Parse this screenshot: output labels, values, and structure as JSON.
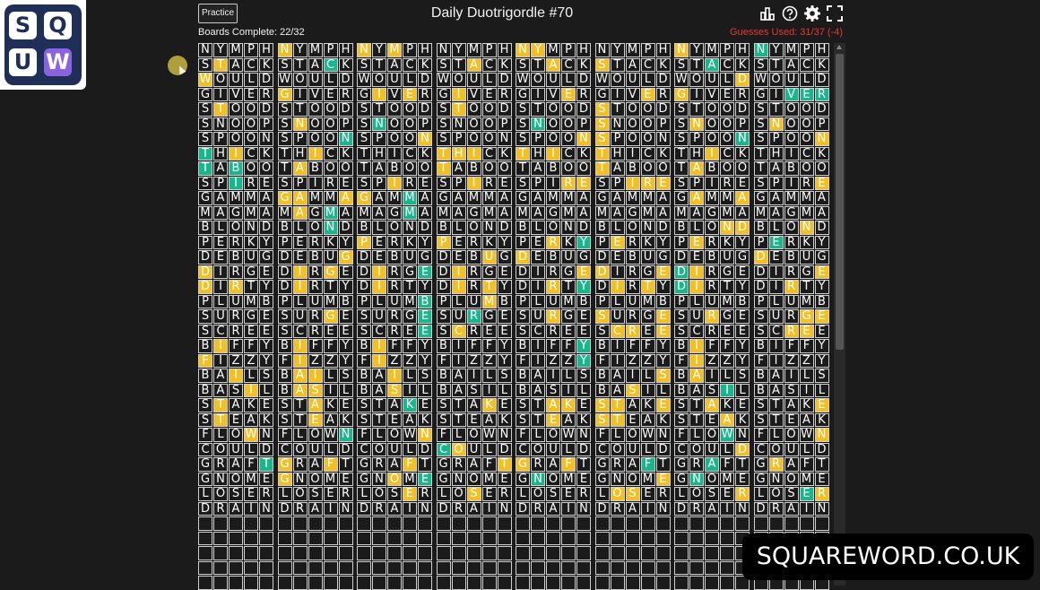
{
  "logo": {
    "letters": [
      "S",
      "Q",
      "U",
      "W"
    ]
  },
  "header": {
    "practice_label": "Practice",
    "title": "Daily Duotrigordle #70",
    "boards_complete": "Boards Complete: 22/32",
    "guesses_used": "Guesses Used: 31/37 (-4)"
  },
  "icons": [
    "stats-icon",
    "help-icon",
    "settings-icon",
    "fullscreen-icon"
  ],
  "colors": {
    "yellow": "#f2c023",
    "green": "#19b58c",
    "background": "#1b1b1b",
    "error": "#e53935"
  },
  "watermark": "SQUAREWORD.CO.UK",
  "guesses": [
    "NYMPH",
    "STACK",
    "WOULD",
    "GIVER",
    "STOOD",
    "SNOOP",
    "SPOON",
    "THICK",
    "TABOO",
    "SPIRE",
    "GAMMA",
    "MAGMA",
    "BLOND",
    "PERKY",
    "DEBUG",
    "DIRGE",
    "DIRTY",
    "PLUMB",
    "SURGE",
    "SCREE",
    "BIFFY",
    "FIZZY",
    "BAILS",
    "BASIL",
    "STAKE",
    "STEAK",
    "FLOWN",
    "COULD",
    "GRAFT",
    "GNOME",
    "LOSER",
    "DRAIN"
  ],
  "boards": [
    [
      "-----",
      "-Y---",
      "Y----",
      "-----",
      "-Y---",
      "-----",
      "-----",
      "G-Y--",
      "G-G--",
      "--G--",
      "-----",
      "-----",
      "-----",
      "-----",
      "-----",
      "Y----",
      "Y-Y--",
      "-----",
      "-----",
      "-----",
      "-Y---",
      "Y----",
      "--Y--",
      "---Y-",
      "-Y---",
      "-Y---",
      "---Y-",
      "-----",
      "----G",
      "-----",
      "-----",
      "-----"
    ],
    [
      "Y----",
      "---G-",
      "-----",
      "Y----",
      "-----",
      "-Y---",
      "----G",
      "--Y--",
      "-Y---",
      "-----",
      "YY--Y",
      "-Y-G-",
      "---G-",
      "-----",
      "----Y",
      "-Y-Y-",
      "-Y---",
      "-----",
      "---Y-",
      "-----",
      "-Y---",
      "-Y---",
      "-YY--",
      "-YY--",
      "--Y--",
      "--Y--",
      "----G",
      "-----",
      "Y--Y-",
      "Y----",
      "-----",
      "-----"
    ],
    [
      "Y-Y--",
      "-----",
      "-----",
      "-Y-Y-",
      "-----",
      "-G---",
      "----Y",
      "-----",
      "-----",
      "--Y--",
      "Y--G-",
      "---G-",
      "-----",
      "Y----",
      "-----",
      "-Y--G",
      "-Y---",
      "----G",
      "----G",
      "----G",
      "-Y---",
      "-Y---",
      "--Y--",
      "--Y--",
      "---G-",
      "-----",
      "----Y",
      "-----",
      "---Y-",
      "--Y-G",
      "---Y-",
      "-----"
    ],
    [
      "-----",
      "--Y--",
      "-----",
      "-Y---",
      "-Y---",
      "-----",
      "-----",
      "YYY--",
      "Y----",
      "--Y--",
      "-----",
      "-----",
      "-----",
      "Y----",
      "---Y-",
      "-Y---",
      "-Y-Y-",
      "---Y-",
      "--G--",
      "-Y---",
      "-----",
      "-----",
      "-----",
      "-----",
      "---Y-",
      "-----",
      "-----",
      "GY---",
      "----Y",
      "-----",
      "--Y--",
      "-----"
    ],
    [
      "YY---",
      "--Y--",
      "-----",
      "---Y-",
      "-----",
      "-G---",
      "----Y",
      "Y-Y--",
      "-----",
      "---YY",
      "-----",
      "-----",
      "-----",
      "--Y-G",
      "Y----",
      "----Y",
      "--Y-G",
      "-----",
      "--Y--",
      "-----",
      "----G",
      "----G",
      "-----",
      "-----",
      "--YY-",
      "--Y--",
      "-----",
      "-----",
      "Y--Y-",
      "-G---",
      "-----",
      "-----"
    ],
    [
      "-----",
      "Y----",
      "-----",
      "---Y-",
      "Y----",
      "Y----",
      "Y----",
      "Y----",
      "Y----",
      "--YYY",
      "-----",
      "-----",
      "-----",
      "-Y---",
      "-----",
      "Y---Y",
      "-Y-Y-",
      "-----",
      "Y---Y",
      "-YY-Y",
      "-----",
      "-----",
      "----Y",
      "--Y--",
      "YY--Y",
      "YY---",
      "-----",
      "-----",
      "---G-",
      "----Y",
      "-YY--",
      "-----"
    ],
    [
      "Y----",
      "--G--",
      "----Y",
      "Y----",
      "-----",
      "-Y---",
      "----G",
      "--Y--",
      "-Y---",
      "-----",
      "-Y--Y",
      "-----",
      "---YY",
      "-Y---",
      "-----",
      "GY---",
      "GY---",
      "-----",
      "--Y--",
      "-----",
      "-Y---",
      "-Y---",
      "-Y---",
      "---G-",
      "--Y--",
      "---Y-",
      "---G-",
      "----Y",
      "--G--",
      "-G---",
      "----Y",
      "-----"
    ],
    [
      "G----",
      "-----",
      "-----",
      "--GGG",
      "-----",
      "-Y---",
      "----Y",
      "-----",
      "-----",
      "----Y",
      "-----",
      "-----",
      "---Y-",
      "-G---",
      "Y----",
      "----Y",
      "--Y--",
      "-----",
      "---YY",
      "--YY-",
      "-----",
      "-----",
      "-----",
      "-----",
      "----Y",
      "-----",
      "----Y",
      "-----",
      "-Y---",
      "-----",
      "---GY",
      "-----"
    ]
  ]
}
